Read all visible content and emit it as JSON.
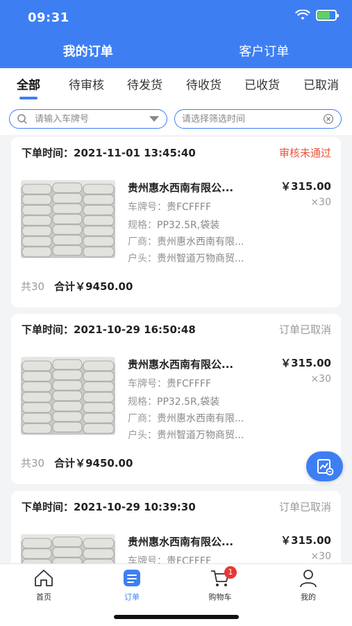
{
  "status_bar": {
    "time": "09:31"
  },
  "top_tabs": [
    {
      "label": "我的订单",
      "active": true
    },
    {
      "label": "客户订单",
      "active": false
    }
  ],
  "filter_tabs": [
    {
      "label": "全部",
      "active": true
    },
    {
      "label": "待审核",
      "active": false
    },
    {
      "label": "待发货",
      "active": false
    },
    {
      "label": "待收货",
      "active": false
    },
    {
      "label": "已收货",
      "active": false
    },
    {
      "label": "已取消",
      "active": false
    }
  ],
  "search": {
    "plate_placeholder": "请输入车牌号",
    "time_placeholder": "请选择筛选时间"
  },
  "orders": [
    {
      "time_label": "下单时间：",
      "time": "2021-11-01 13:45:40",
      "status": "审核未通过",
      "status_color": "#e8553e",
      "product_name": "贵州惠水西南有限公...",
      "price": "￥315.00",
      "qty": "×30",
      "plate_label": "车牌号：",
      "plate": "贵FCFFFF",
      "spec_label": "规格：",
      "spec": "PP32.5R,袋装",
      "maker_label": "厂商：",
      "maker": "贵州惠水西南有限...",
      "account_label": "户头：",
      "account": "贵州智道万物商贸...",
      "count": "共30",
      "total": "合计￥9450.00"
    },
    {
      "time_label": "下单时间：",
      "time": "2021-10-29 16:50:48",
      "status": "订单已取消",
      "status_color": "#999999",
      "product_name": "贵州惠水西南有限公...",
      "price": "￥315.00",
      "qty": "×30",
      "plate_label": "车牌号：",
      "plate": "贵FCFFFF",
      "spec_label": "规格：",
      "spec": "PP32.5R,袋装",
      "maker_label": "厂商：",
      "maker": "贵州惠水西南有限...",
      "account_label": "户头：",
      "account": "贵州智道万物商贸...",
      "count": "共30",
      "total": "合计￥9450.00"
    },
    {
      "time_label": "下单时间：",
      "time": "2021-10-29 10:39:30",
      "status": "订单已取消",
      "status_color": "#999999",
      "product_name": "贵州惠水西南有限公...",
      "price": "￥315.00",
      "qty": "×30",
      "plate_label": "车牌号：",
      "plate": "贵FCFFFF"
    }
  ],
  "bottom_nav": [
    {
      "label": "首页",
      "icon": "home-icon",
      "active": false
    },
    {
      "label": "订单",
      "icon": "order-icon",
      "active": true
    },
    {
      "label": "购物车",
      "icon": "cart-icon",
      "active": false,
      "badge": "1"
    },
    {
      "label": "我的",
      "icon": "profile-icon",
      "active": false
    }
  ],
  "colors": {
    "primary": "#3d7ff3",
    "danger": "#e8553e",
    "muted": "#999999"
  }
}
